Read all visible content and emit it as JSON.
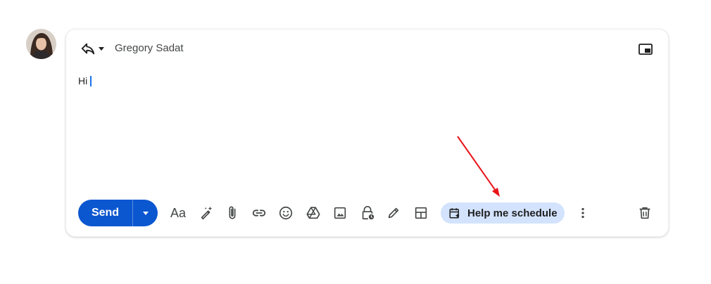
{
  "composer": {
    "recipient": "Gregory Sadat",
    "body_text": "Hi"
  },
  "toolbar": {
    "send_label": "Send",
    "format_label": "Aa",
    "help_schedule_label": "Help me schedule"
  },
  "icons": {
    "reply": "reply-icon",
    "reply_menu": "arrow-drop-down-icon",
    "popout": "picture-in-picture-icon",
    "send_options": "arrow-drop-down-icon",
    "magic": "magic-pen-icon",
    "attach": "paperclip-icon",
    "link": "link-icon",
    "emoji": "emoji-icon",
    "drive": "google-drive-icon",
    "photo": "image-icon",
    "confidential": "lock-clock-icon",
    "signature": "pen-icon",
    "layouts": "layout-icon",
    "calendar": "calendar-sparkle-icon",
    "more": "more-vert-icon",
    "discard": "trash-icon"
  },
  "colors": {
    "send_blue": "#0b57d0",
    "chip_bg": "#d3e3fd",
    "icon_gray": "#444746",
    "annotation_red": "#e8141a",
    "caret_blue": "#1a73e8"
  }
}
